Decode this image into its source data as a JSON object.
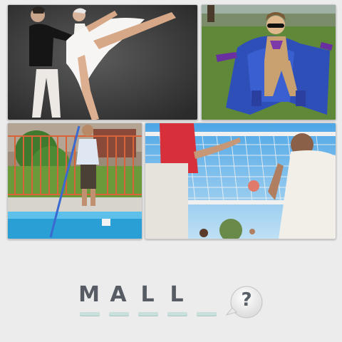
{
  "puzzle": {
    "images": [
      {
        "icon": "ballet-dancers-photo"
      },
      {
        "icon": "caped-superhero-photo"
      },
      {
        "icon": "pool-cleaner-photo"
      },
      {
        "icon": "volleyball-players-photo"
      }
    ],
    "answer_slots": [
      {
        "letter": "M"
      },
      {
        "letter": "A"
      },
      {
        "letter": "L"
      },
      {
        "letter": "L"
      },
      {
        "letter": ""
      }
    ],
    "hint_button": {
      "label": "?",
      "icon": "speech-bubble-question-icon"
    }
  },
  "colors": {
    "background": "#ececec",
    "letter": "#575c64",
    "slot_underline": "#c8dfdc"
  }
}
